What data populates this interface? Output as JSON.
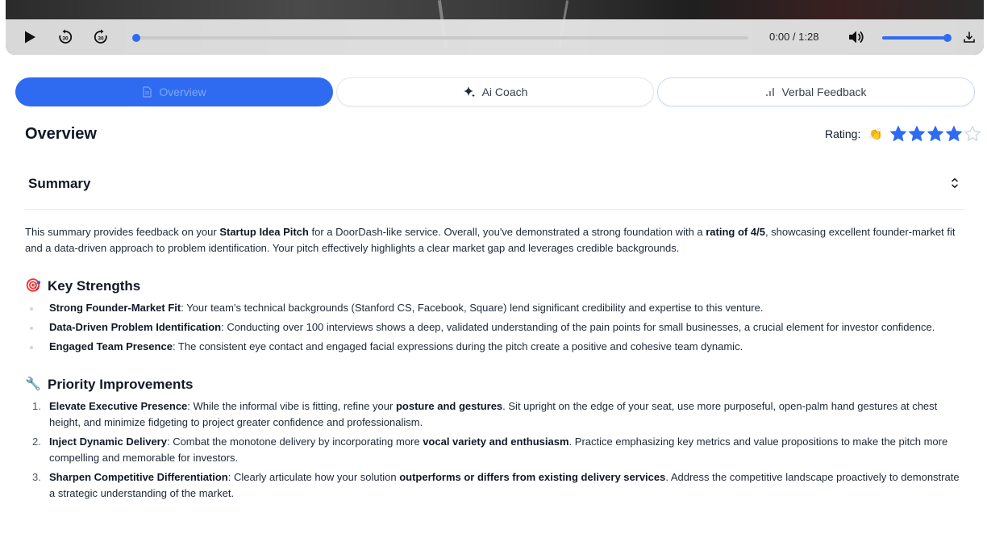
{
  "player": {
    "time": "0:00 / 1:28",
    "progress": 0,
    "volume": 1.0,
    "icons": {
      "play": "play-icon",
      "rewind": "rewind-30-icon",
      "forward": "forward-30-icon",
      "volume": "volume-icon",
      "download": "download-icon"
    },
    "accent": "#2f6bf0"
  },
  "tabs": [
    {
      "label": "Overview",
      "icon": "document-icon",
      "active": true
    },
    {
      "label": "Ai Coach",
      "icon": "sparkle-icon",
      "active": false
    },
    {
      "label": "Verbal Feedback",
      "icon": "bar-chart-icon",
      "active": false
    }
  ],
  "overview": {
    "title": "Overview",
    "rating_label": "Rating:",
    "rating_emoji": "👏",
    "rating_value": 4,
    "rating_max": 5
  },
  "summary": {
    "title": "Summary",
    "intro": [
      {
        "t": "This summary provides feedback on your "
      },
      {
        "t": "Startup Idea Pitch",
        "b": true
      },
      {
        "t": " for a DoorDash-like service. Overall, you've demonstrated a strong foundation with a "
      },
      {
        "t": "rating of 4/5",
        "b": true
      },
      {
        "t": ", showcasing excellent founder-market fit and a data-driven approach to problem identification. Your pitch effectively highlights a clear market gap and leverages credible backgrounds."
      }
    ],
    "strengths_emoji": "🎯",
    "strengths_title": "Key Strengths",
    "strengths": [
      [
        {
          "t": "Strong Founder-Market Fit",
          "b": true
        },
        {
          "t": ": Your team's technical backgrounds (Stanford CS, Facebook, Square) lend significant credibility and expertise to this venture."
        }
      ],
      [
        {
          "t": "Data-Driven Problem Identification",
          "b": true
        },
        {
          "t": ": Conducting over 100 interviews shows a deep, validated understanding of the pain points for small businesses, a crucial element for investor confidence."
        }
      ],
      [
        {
          "t": "Engaged Team Presence",
          "b": true
        },
        {
          "t": ": The consistent eye contact and engaged facial expressions during the pitch create a positive and cohesive team dynamic."
        }
      ]
    ],
    "improvements_emoji": "🔧",
    "improvements_title": "Priority Improvements",
    "improvements": [
      [
        {
          "t": "Elevate Executive Presence",
          "b": true
        },
        {
          "t": ": While the informal vibe is fitting, refine your "
        },
        {
          "t": "posture and gestures",
          "b": true
        },
        {
          "t": ". Sit upright on the edge of your seat, use more purposeful, open-palm hand gestures at chest height, and minimize fidgeting to project greater confidence and professionalism."
        }
      ],
      [
        {
          "t": "Inject Dynamic Delivery",
          "b": true
        },
        {
          "t": ": Combat the monotone delivery by incorporating more "
        },
        {
          "t": "vocal variety and enthusiasm",
          "b": true
        },
        {
          "t": ". Practice emphasizing key metrics and value propositions to make the pitch more compelling and memorable for investors."
        }
      ],
      [
        {
          "t": "Sharpen Competitive Differentiation",
          "b": true
        },
        {
          "t": ": Clearly articulate how your solution "
        },
        {
          "t": "outperforms or differs from existing delivery services",
          "b": true
        },
        {
          "t": ". Address the competitive landscape proactively to demonstrate a strategic understanding of the market."
        }
      ]
    ]
  }
}
